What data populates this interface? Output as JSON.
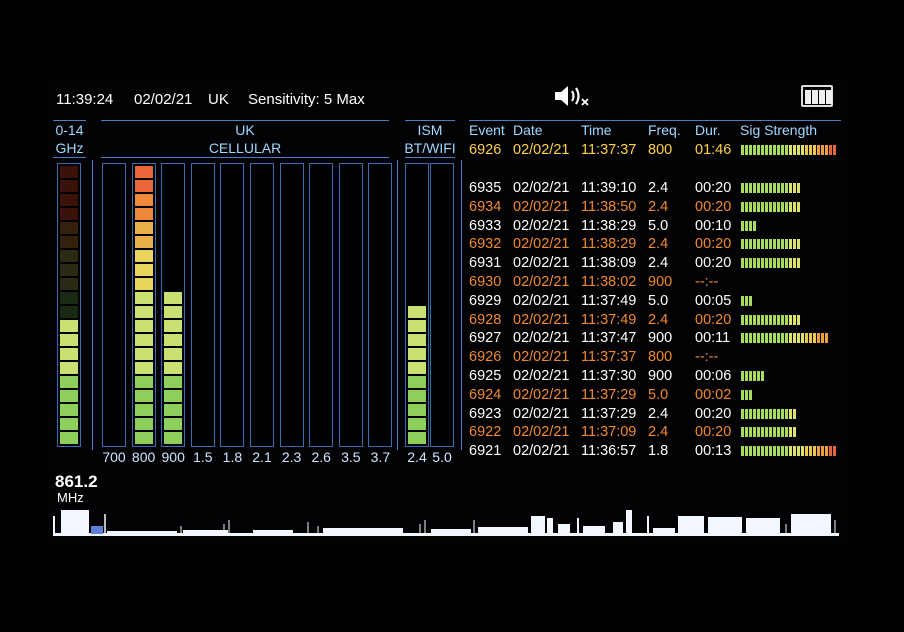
{
  "status": {
    "clock": "11:39:24",
    "date": "02/02/21",
    "region": "UK",
    "sensitivity": "Sensitivity: 5 Max",
    "speaker_icon": "speaker-muted-icon",
    "battery_icon": "battery-icon"
  },
  "wideband": {
    "range": "0-14",
    "unit": "GHz",
    "level": 0.45
  },
  "cellular": {
    "title": "UK",
    "subtitle": "CELLULAR",
    "bands": [
      {
        "label": "700",
        "level": 0
      },
      {
        "label": "800",
        "level": 1.0
      },
      {
        "label": "900",
        "level": 0.55
      },
      {
        "label": "1.5",
        "level": 0
      },
      {
        "label": "1.8",
        "level": 0
      },
      {
        "label": "2.1",
        "level": 0
      },
      {
        "label": "2.3",
        "level": 0
      },
      {
        "label": "2.6",
        "level": 0
      },
      {
        "label": "3.5",
        "level": 0
      },
      {
        "label": "3.7",
        "level": 0
      }
    ]
  },
  "ism": {
    "title": "ISM",
    "subtitle": "BT/WIFI",
    "bands": [
      {
        "label": "2.4",
        "level": 0.5
      },
      {
        "label": "5.0",
        "level": 0
      }
    ]
  },
  "events": {
    "headers": {
      "event": "Event",
      "date": "Date",
      "time": "Time",
      "freq": "Freq.",
      "dur": "Dur.",
      "sig": "Sig Strength"
    },
    "pinned": {
      "event": "6926",
      "date": "02/02/21",
      "time": "11:37:37",
      "freq": "800",
      "dur": "01:46",
      "sig": 24,
      "color": "#ffd24a"
    },
    "rows": [
      {
        "event": "6935",
        "date": "02/02/21",
        "time": "11:39:10",
        "freq": "2.4",
        "dur": "00:20",
        "sig": 15,
        "color": "#ffffff"
      },
      {
        "event": "6934",
        "date": "02/02/21",
        "time": "11:38:50",
        "freq": "2.4",
        "dur": "00:20",
        "sig": 15,
        "color": "#f08a2e"
      },
      {
        "event": "6933",
        "date": "02/02/21",
        "time": "11:38:29",
        "freq": "5.0",
        "dur": "00:10",
        "sig": 4,
        "color": "#ffffff"
      },
      {
        "event": "6932",
        "date": "02/02/21",
        "time": "11:38:29",
        "freq": "2.4",
        "dur": "00:20",
        "sig": 15,
        "color": "#f08a2e"
      },
      {
        "event": "6931",
        "date": "02/02/21",
        "time": "11:38:09",
        "freq": "2.4",
        "dur": "00:20",
        "sig": 15,
        "color": "#ffffff"
      },
      {
        "event": "6930",
        "date": "02/02/21",
        "time": "11:38:02",
        "freq": "900",
        "dur": "--:--",
        "sig": 0,
        "color": "#f08a2e"
      },
      {
        "event": "6929",
        "date": "02/02/21",
        "time": "11:37:49",
        "freq": "5.0",
        "dur": "00:05",
        "sig": 3,
        "color": "#ffffff"
      },
      {
        "event": "6928",
        "date": "02/02/21",
        "time": "11:37:49",
        "freq": "2.4",
        "dur": "00:20",
        "sig": 15,
        "color": "#f08a2e"
      },
      {
        "event": "6927",
        "date": "02/02/21",
        "time": "11:37:47",
        "freq": "900",
        "dur": "00:11",
        "sig": 22,
        "color": "#ffffff"
      },
      {
        "event": "6926",
        "date": "02/02/21",
        "time": "11:37:37",
        "freq": "800",
        "dur": "--:--",
        "sig": 0,
        "color": "#f08a2e"
      },
      {
        "event": "6925",
        "date": "02/02/21",
        "time": "11:37:30",
        "freq": "900",
        "dur": "00:06",
        "sig": 6,
        "color": "#ffffff"
      },
      {
        "event": "6924",
        "date": "02/02/21",
        "time": "11:37:29",
        "freq": "5.0",
        "dur": "00:02",
        "sig": 3,
        "color": "#f08a2e"
      },
      {
        "event": "6923",
        "date": "02/02/21",
        "time": "11:37:29",
        "freq": "2.4",
        "dur": "00:20",
        "sig": 14,
        "color": "#ffffff"
      },
      {
        "event": "6922",
        "date": "02/02/21",
        "time": "11:37:09",
        "freq": "2.4",
        "dur": "00:20",
        "sig": 14,
        "color": "#f08a2e"
      },
      {
        "event": "6921",
        "date": "02/02/21",
        "time": "11:36:57",
        "freq": "1.8",
        "dur": "00:13",
        "sig": 24,
        "color": "#ffffff"
      }
    ]
  },
  "spectrum": {
    "frequency": "861.2",
    "unit": "MHz"
  }
}
